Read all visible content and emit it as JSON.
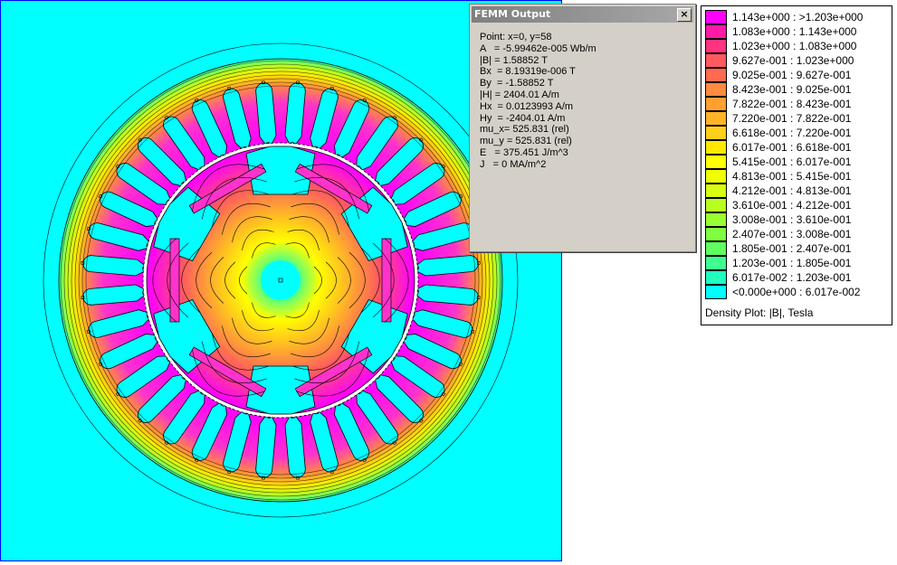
{
  "plot": {
    "background": "#00ffff",
    "frame_color": "#0000ff"
  },
  "output_window": {
    "title": "FEMM Output",
    "close_label": "×",
    "lines": [
      "Point: x=0, y=58",
      "A   = -5.99462e-005 Wb/m",
      "|B| = 1.58852 T",
      "Bx  = 8.19319e-006 T",
      "By  = -1.58852 T",
      "|H| = 2404.01 A/m",
      "Hx  = 0.0123993 A/m",
      "Hy  = -2404.01 A/m",
      "mu_x= 525.831 (rel)",
      "mu_y = 525.831 (rel)",
      "E   = 375.451 J/m^3",
      "J   = 0 MA/m^2"
    ]
  },
  "legend": {
    "caption": "Density Plot: |B|, Tesla",
    "entries": [
      {
        "color": "#ff00ff",
        "label": "1.143e+000 : >1.203e+000"
      },
      {
        "color": "#ff1aa6",
        "label": "1.083e+000 : 1.143e+000"
      },
      {
        "color": "#ff3380",
        "label": "1.023e+000 : 1.083e+000"
      },
      {
        "color": "#ff5a60",
        "label": "9.627e-001 : 1.023e+000"
      },
      {
        "color": "#ff6a50",
        "label": "9.025e-001 : 9.627e-001"
      },
      {
        "color": "#ff8a40",
        "label": "8.423e-001 : 9.025e-001"
      },
      {
        "color": "#ffa030",
        "label": "7.822e-001 : 8.423e-001"
      },
      {
        "color": "#ffb428",
        "label": "7.220e-001 : 7.822e-001"
      },
      {
        "color": "#ffd01a",
        "label": "6.618e-001 : 7.220e-001"
      },
      {
        "color": "#ffe800",
        "label": "6.017e-001 : 6.618e-001"
      },
      {
        "color": "#ffff00",
        "label": "5.415e-001 : 6.017e-001"
      },
      {
        "color": "#f0ff00",
        "label": "4.813e-001 : 5.415e-001"
      },
      {
        "color": "#d8ff10",
        "label": "4.212e-001 : 4.813e-001"
      },
      {
        "color": "#b8ff20",
        "label": "3.610e-001 : 4.212e-001"
      },
      {
        "color": "#98ff30",
        "label": "3.008e-001 : 3.610e-001"
      },
      {
        "color": "#80ff40",
        "label": "2.407e-001 : 3.008e-001"
      },
      {
        "color": "#60ff60",
        "label": "1.805e-001 : 2.407e-001"
      },
      {
        "color": "#40ff90",
        "label": "1.203e-001 : 1.805e-001"
      },
      {
        "color": "#20ffc0",
        "label": "6.017e-002 : 1.203e-001"
      },
      {
        "color": "#00ffff",
        "label": "<0.000e+000 : 6.017e-002"
      }
    ]
  }
}
